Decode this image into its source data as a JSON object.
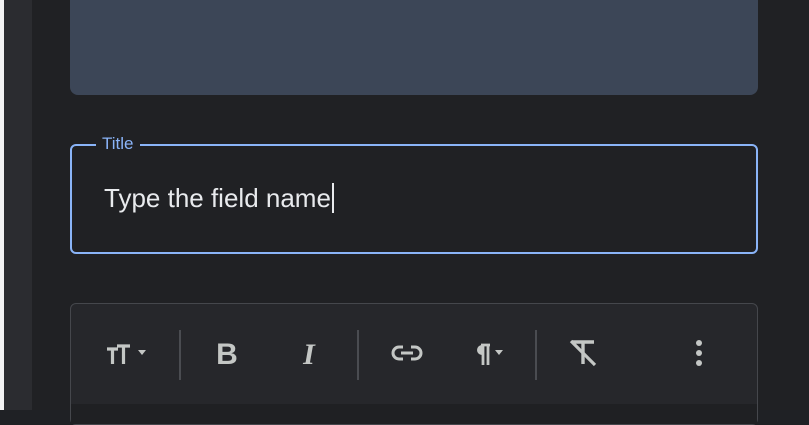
{
  "title_field": {
    "label": "Title",
    "value": "Type the field name"
  },
  "toolbar": {
    "bold_label": "B",
    "italic_label": "I",
    "icons": [
      "text-size-icon",
      "bold-icon",
      "italic-icon",
      "link-icon",
      "paragraph-icon",
      "clear-formatting-icon",
      "more-vert-icon"
    ]
  },
  "colors": {
    "accent": "#8ab4f8",
    "background": "#202124",
    "image_placeholder": "#3c4657"
  }
}
